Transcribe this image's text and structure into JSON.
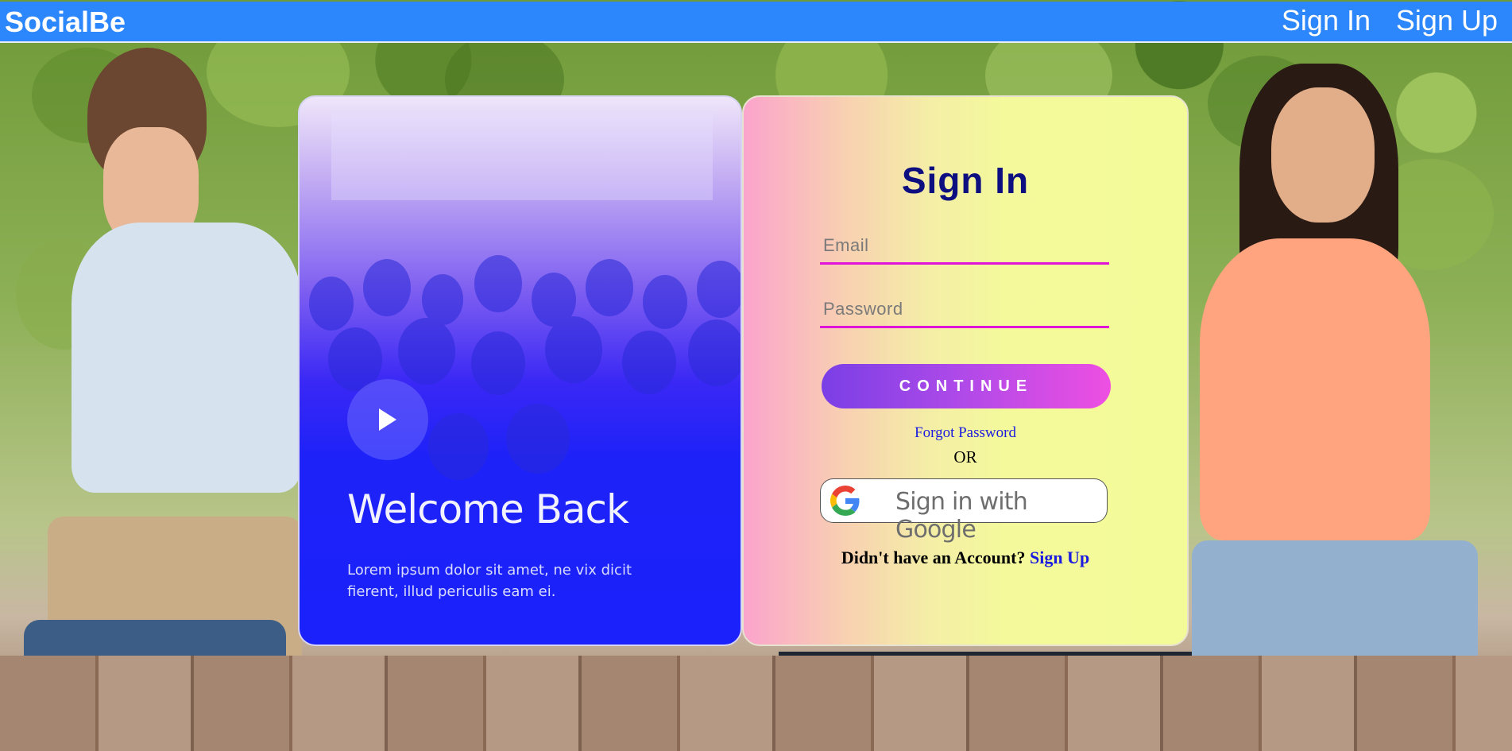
{
  "navbar": {
    "brand": "SocialBe",
    "signin_label": "Sign In",
    "signup_label": "Sign Up",
    "background_color": "#2c86fc"
  },
  "left_card": {
    "heading": "Welcome Back",
    "body": "Lorem ipsum dolor sit amet, ne vix dicit fierent, illud periculis eam ei.",
    "play_icon": "play-icon"
  },
  "sign_in": {
    "title": "Sign In",
    "email_placeholder": "Email",
    "password_placeholder": "Password",
    "continue_label": "CONTINUE",
    "forgot_label": "Forgot Password",
    "or_label": "OR",
    "google_label": "Sign in with Google",
    "account_prompt": "Didn't have an Account?",
    "signup_link": "Sign Up"
  },
  "colors": {
    "title": "#0d0f80",
    "link": "#1a1ae0",
    "field_underline": "#e013d9",
    "button_start": "#7a3fe6",
    "button_end": "#ee4fe2"
  }
}
